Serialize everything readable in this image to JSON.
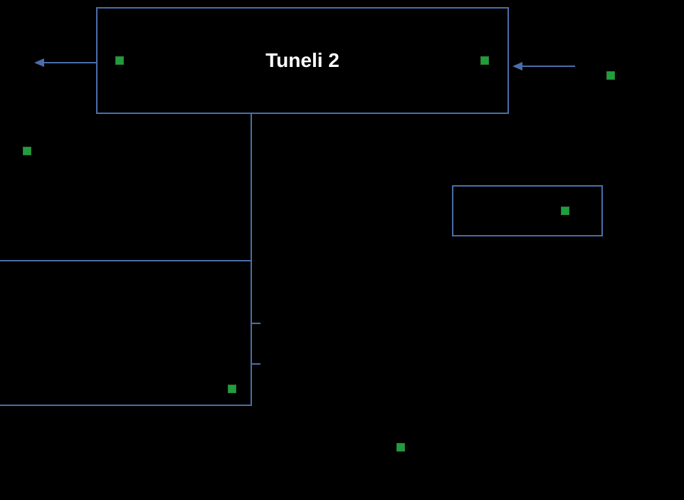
{
  "diagram": {
    "main_box_label": "Tuneli 2",
    "colors": {
      "stroke": "#4a6ea9",
      "marker": "#1e9e3e",
      "bg": "#000000",
      "text": "#ffffff"
    }
  }
}
